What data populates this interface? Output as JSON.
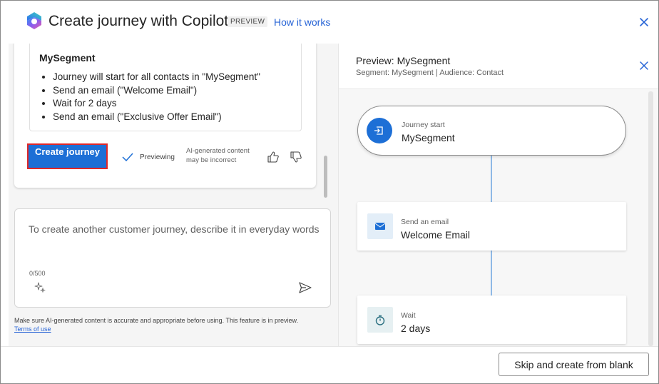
{
  "header": {
    "title": "Create journey with Copilot",
    "badge": "PREVIEW",
    "how_it_works": "How it works"
  },
  "summary": {
    "segment_name": "MySegment",
    "steps": [
      "Journey will start for all contacts in \"MySegment\"",
      "Send an email (\"Welcome Email\")",
      "Wait for 2 days",
      "Send an email (\"Exclusive Offer Email\")"
    ],
    "create_button": "Create journey",
    "previewing": "Previewing",
    "ai_note": "AI-generated content may be incorrect"
  },
  "prompt": {
    "placeholder": "To create another customer journey, describe it in everyday words",
    "char_count": "0/500"
  },
  "disclaimer": "Make sure AI-generated content is accurate and appropriate before using. This feature is in preview.",
  "terms_link": "Terms of use",
  "preview": {
    "title": "Preview: MySegment",
    "subtitle": "Segment: MySegment | Audience: Contact",
    "nodes": [
      {
        "label": "Journey start",
        "value": "MySegment"
      },
      {
        "label": "Send an email",
        "value": "Welcome Email"
      },
      {
        "label": "Wait",
        "value": "2 days"
      }
    ]
  },
  "footer": {
    "skip_button": "Skip and create from blank"
  },
  "colors": {
    "accent": "#1d6fd6",
    "link": "#2764d6",
    "highlight_border": "#e02828",
    "connector": "#8fb9e6"
  },
  "icons": [
    "copilot-logo-icon",
    "close-icon",
    "check-icon",
    "thumbs-up-icon",
    "thumbs-down-icon",
    "sparkle-icon",
    "send-icon",
    "journey-start-icon",
    "email-icon",
    "timer-icon"
  ]
}
